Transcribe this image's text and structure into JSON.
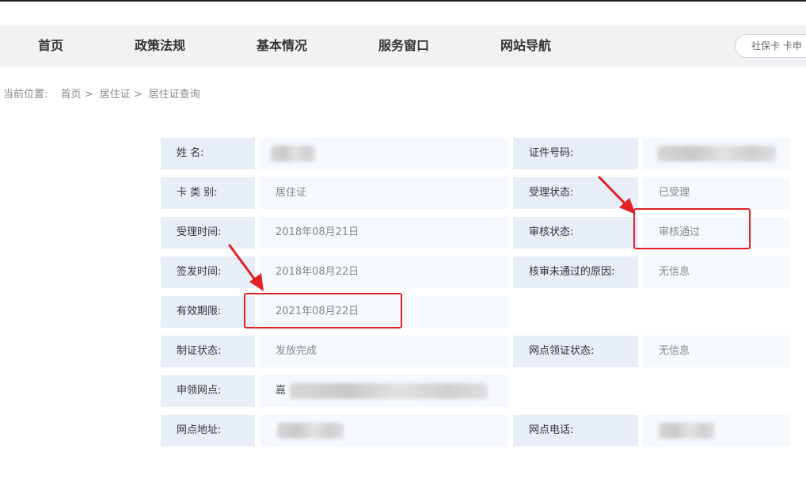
{
  "nav": {
    "items": [
      "首页",
      "政策法规",
      "基本情况",
      "服务窗口",
      "网站导航"
    ],
    "search_text": "社保卡  卡申"
  },
  "breadcrumb": {
    "prefix": "当前位置:",
    "home": "首页",
    "level1": "居住证",
    "level2": "居住证查询",
    "sep": ">"
  },
  "info": {
    "name_label": "姓  名:",
    "id_label": "证件号码:",
    "card_type_label": "卡 类 别:",
    "card_type_value": "居住证",
    "accept_status_label": "受理状态:",
    "accept_status_value": "已受理",
    "accept_time_label": "受理时间:",
    "accept_time_value": "2018年08月21日",
    "review_status_label": "审核状态:",
    "review_status_value": "审核通过",
    "issue_time_label": "签发时间:",
    "issue_time_value": "2018年08月22日",
    "reject_reason_label": "核审未通过的原因:",
    "reject_reason_value": "无信息",
    "valid_until_label": "有效期限:",
    "valid_until_value": "2021年08月22日",
    "make_status_label": "制证状态:",
    "make_status_value": "发放完成",
    "pickup_status_label": "网点领证状态:",
    "pickup_status_value": "无信息",
    "apply_point_label": "申领网点:",
    "apply_point_value": "嘉",
    "point_address_label": "网点地址:",
    "point_phone_label": "网点电话:"
  },
  "annotation": {
    "color": "#e32025"
  }
}
